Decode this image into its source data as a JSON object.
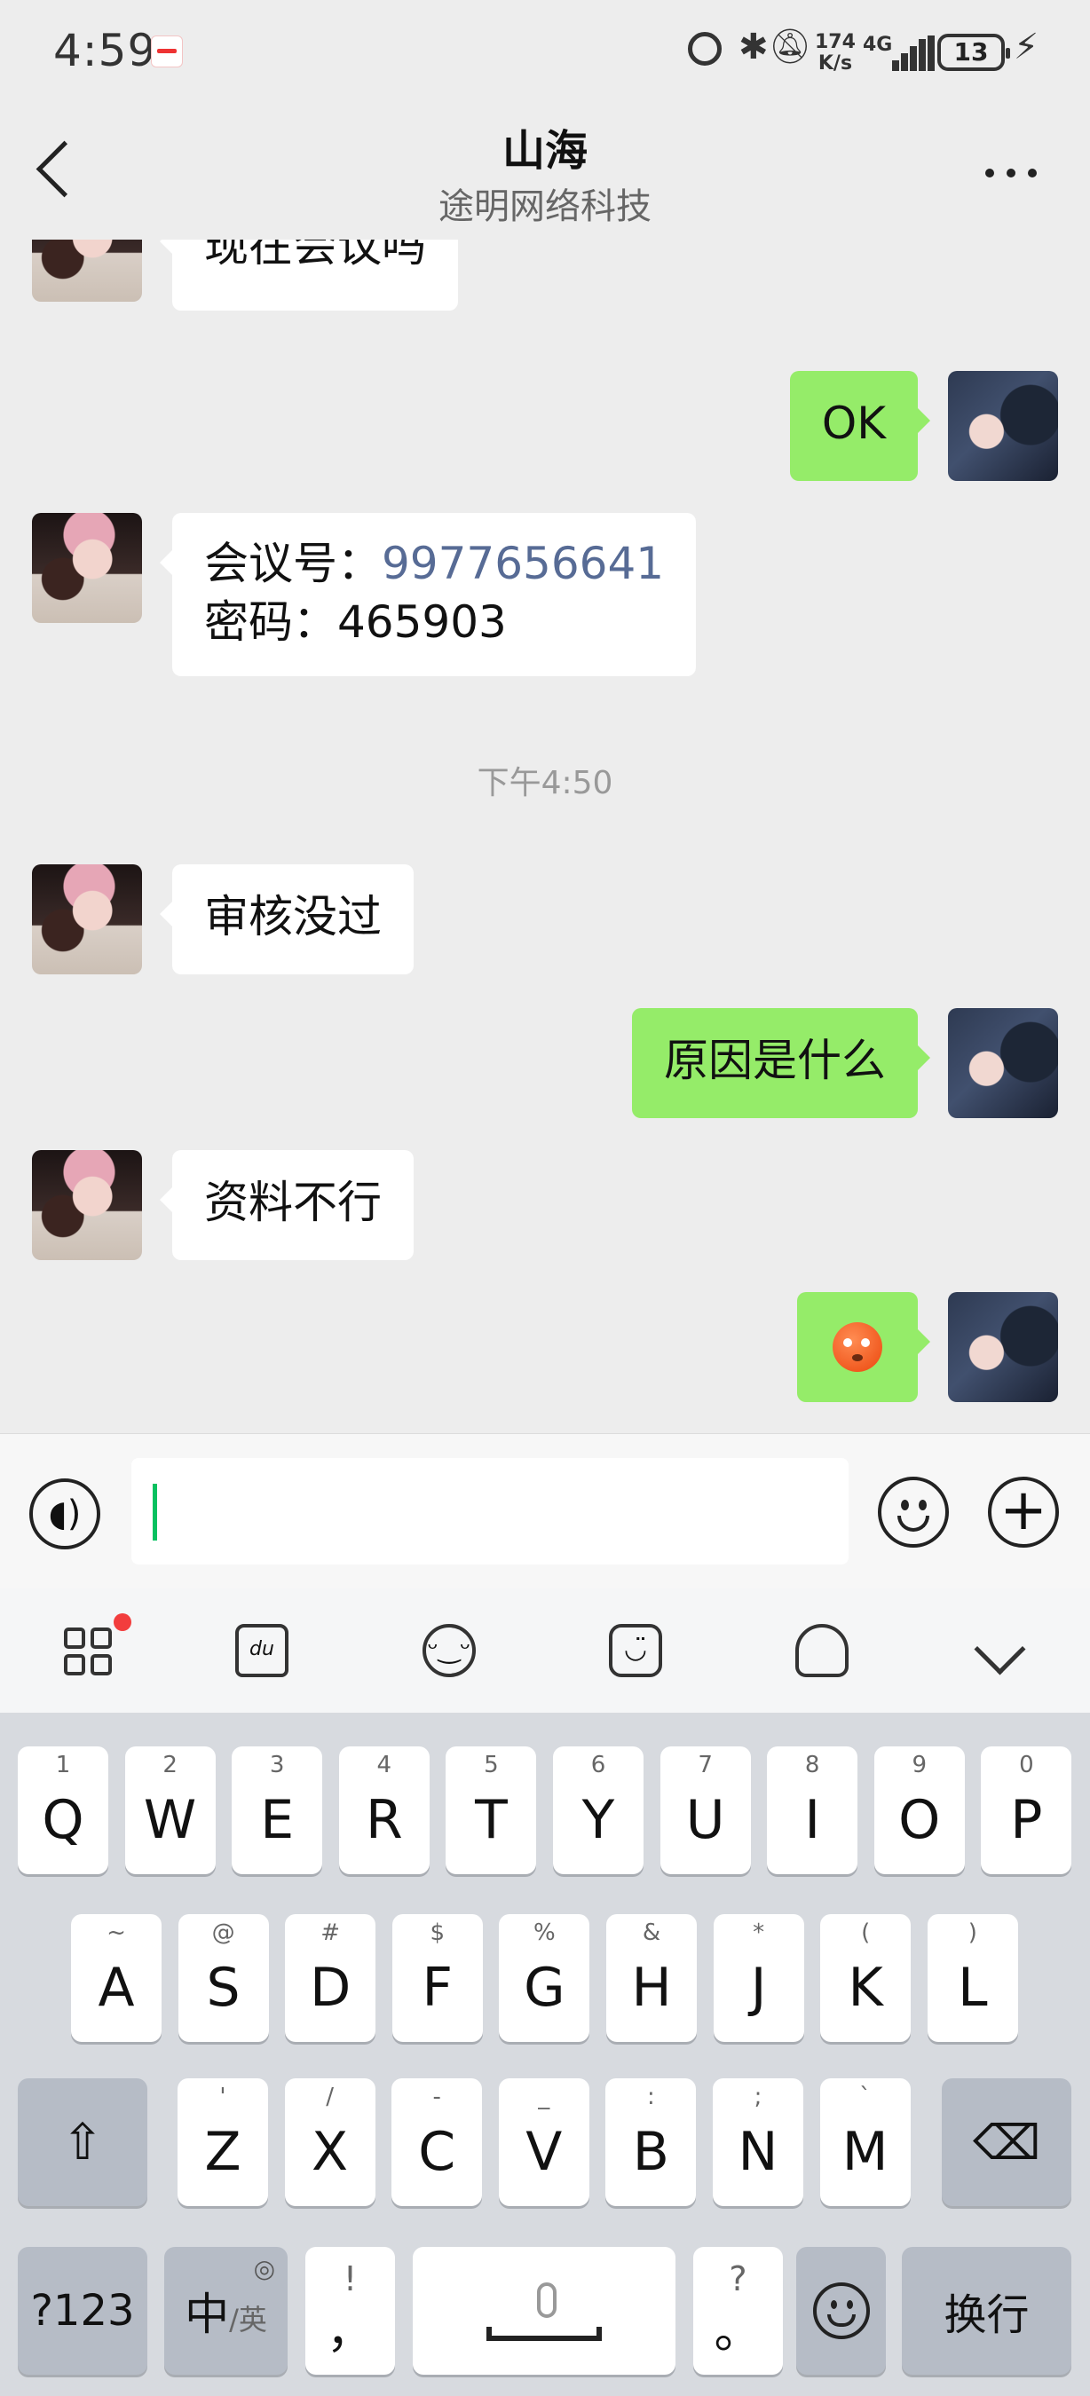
{
  "status_bar": {
    "time": "4:59",
    "network_speed_value": "174",
    "network_speed_unit": "K/s",
    "network_type": "4G",
    "battery": "13"
  },
  "nav": {
    "title": "山海",
    "subtitle": "途明网络科技"
  },
  "messages": [
    {
      "side": "left",
      "text": "现在会议吗"
    },
    {
      "side": "right",
      "text": "OK"
    },
    {
      "side": "left",
      "meeting_label": "会议号：",
      "meeting_number": "9977656641",
      "password_label": "密码：",
      "password": "465903"
    },
    {
      "side": "left",
      "text": "审核没过"
    },
    {
      "side": "right",
      "text": "原因是什么"
    },
    {
      "side": "left",
      "text": "资料不行"
    },
    {
      "side": "right",
      "emoji": "face-emoji"
    }
  ],
  "time_separator": "下午4:50",
  "input": {
    "value": "",
    "placeholder": ""
  },
  "keyboard": {
    "row1": [
      {
        "hint": "1",
        "key": "Q"
      },
      {
        "hint": "2",
        "key": "W"
      },
      {
        "hint": "3",
        "key": "E"
      },
      {
        "hint": "4",
        "key": "R"
      },
      {
        "hint": "5",
        "key": "T"
      },
      {
        "hint": "6",
        "key": "Y"
      },
      {
        "hint": "7",
        "key": "U"
      },
      {
        "hint": "8",
        "key": "I"
      },
      {
        "hint": "9",
        "key": "O"
      },
      {
        "hint": "0",
        "key": "P"
      }
    ],
    "row2": [
      {
        "hint": "~",
        "key": "A"
      },
      {
        "hint": "@",
        "key": "S"
      },
      {
        "hint": "#",
        "key": "D"
      },
      {
        "hint": "$",
        "key": "F"
      },
      {
        "hint": "%",
        "key": "G"
      },
      {
        "hint": "&",
        "key": "H"
      },
      {
        "hint": "*",
        "key": "J"
      },
      {
        "hint": "(",
        "key": "K"
      },
      {
        "hint": ")",
        "key": "L"
      }
    ],
    "row3": [
      {
        "hint": "'",
        "key": "Z"
      },
      {
        "hint": "/",
        "key": "X"
      },
      {
        "hint": "-",
        "key": "C"
      },
      {
        "hint": "_",
        "key": "V"
      },
      {
        "hint": ":",
        "key": "B"
      },
      {
        "hint": ";",
        "key": "N"
      },
      {
        "hint": "`",
        "key": "M"
      }
    ],
    "shift": "⇧",
    "backspace": "⌫",
    "numbers_label": "?123",
    "lang_main": "中",
    "lang_sub": "/英",
    "comma_hint": "!",
    "comma_key": "，",
    "period_hint": "?",
    "period_key": "。",
    "enter_label": "换行"
  },
  "colors": {
    "accent": "#07c160",
    "sent_bubble": "#95ec69",
    "link": "#576b95",
    "notification": "#f23d3d"
  }
}
